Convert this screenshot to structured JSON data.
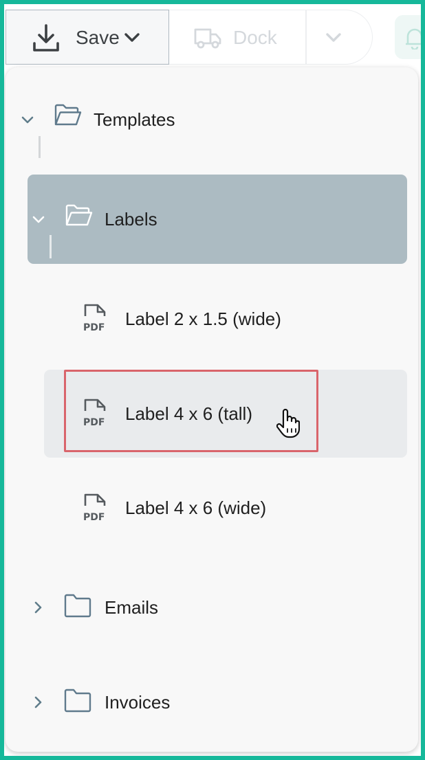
{
  "toolbar": {
    "save_label": "Save",
    "dock_label": "Dock"
  },
  "tree": {
    "templates": {
      "label": "Templates",
      "expanded": true
    },
    "labels": {
      "label": "Labels",
      "expanded": true,
      "selected": true
    },
    "files": [
      {
        "label": "Label 2 x 1.5 (wide)",
        "icon": "pdf-file-icon"
      },
      {
        "label": "Label 4 x 6 (tall)",
        "icon": "pdf-file-icon",
        "hovered": true
      },
      {
        "label": "Label 4 x 6 (wide)",
        "icon": "pdf-file-icon"
      }
    ],
    "emails": {
      "label": "Emails",
      "expanded": false
    },
    "invoices": {
      "label": "Invoices",
      "expanded": false
    }
  },
  "colors": {
    "frame": "#16b89a",
    "selected_row": "#acbbc2",
    "hover_row": "#e9ebed",
    "highlight": "#d9646b",
    "folder_icon": "#5f7a8c"
  }
}
